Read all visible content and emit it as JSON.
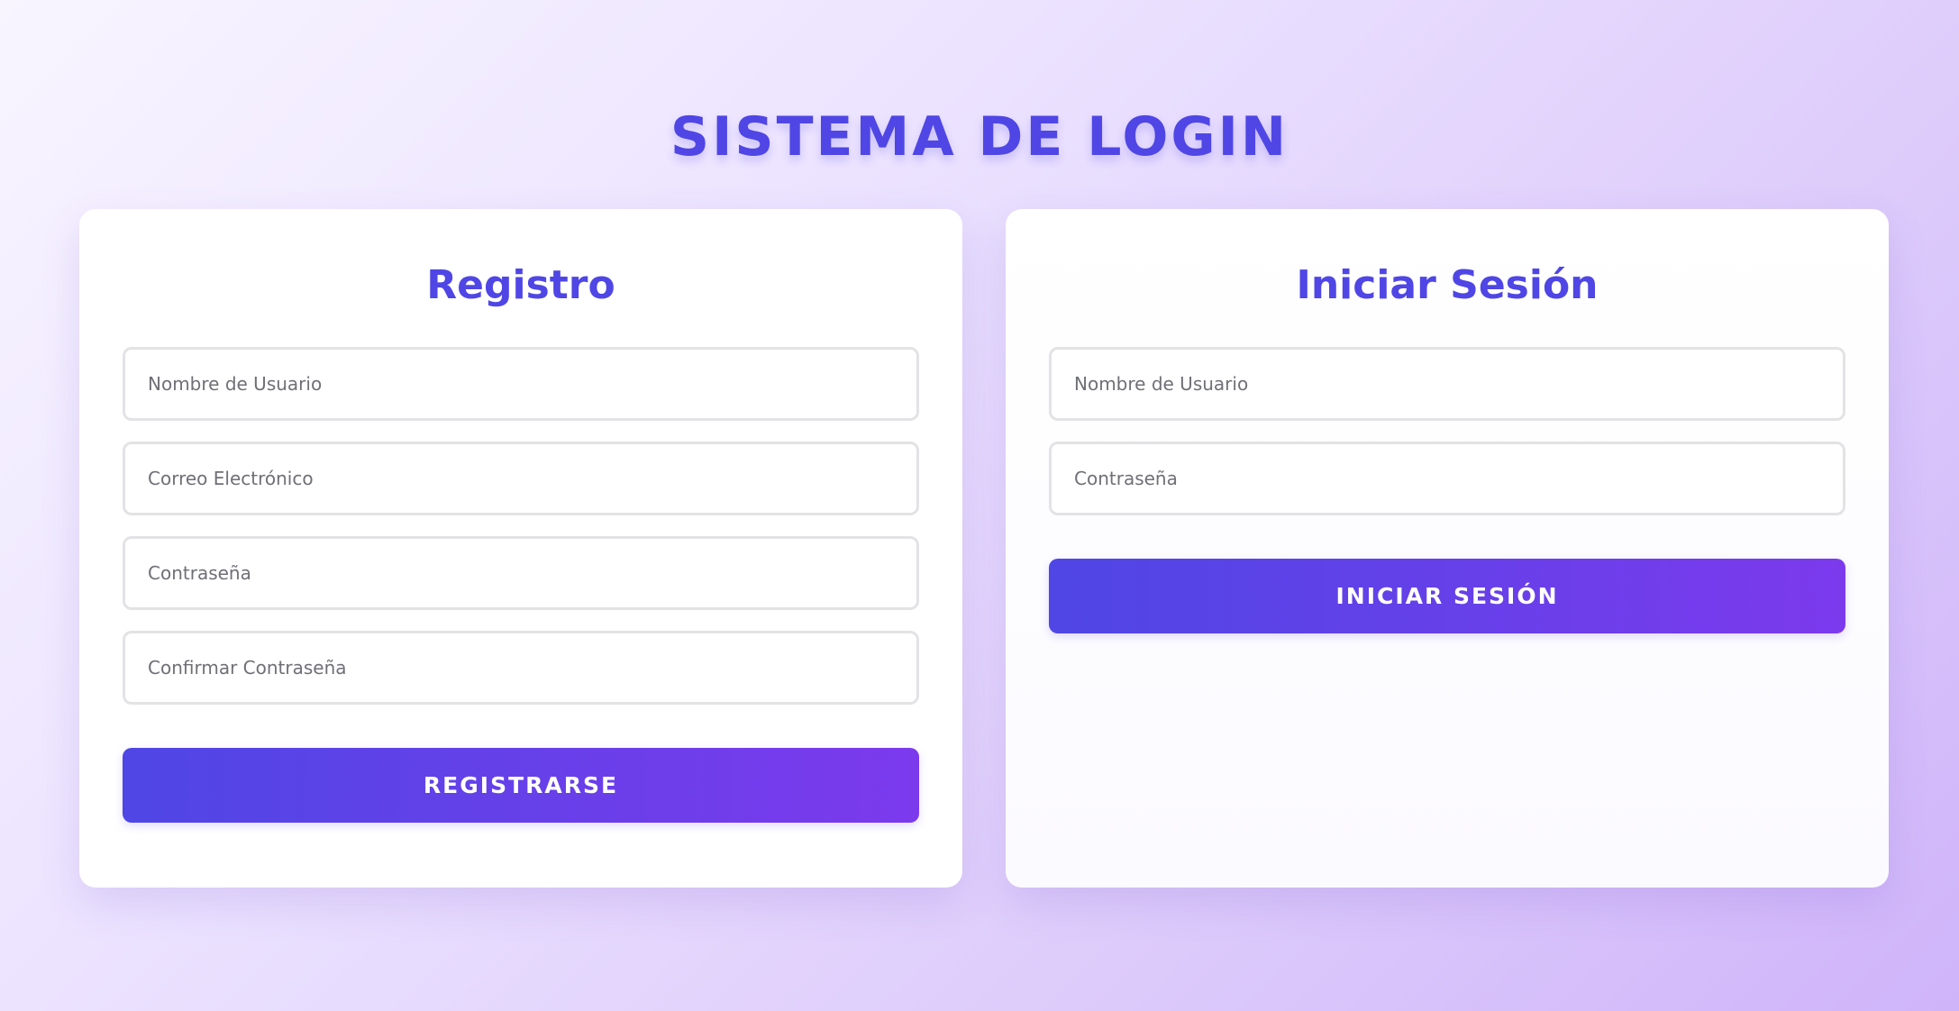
{
  "page": {
    "title": "SISTEMA DE LOGIN"
  },
  "register": {
    "title": "Registro",
    "username_placeholder": "Nombre de Usuario",
    "email_placeholder": "Correo Electrónico",
    "password_placeholder": "Contraseña",
    "confirm_password_placeholder": "Confirmar Contraseña",
    "submit_label": "REGISTRARSE"
  },
  "login": {
    "title": "Iniciar Sesión",
    "username_placeholder": "Nombre de Usuario",
    "password_placeholder": "Contraseña",
    "submit_label": "INICIAR SESIÓN"
  },
  "colors": {
    "accent": "#4f46e5",
    "accent_end": "#7c3aed",
    "background_start": "#f8f5ff",
    "background_end": "#cfb4fa",
    "field_border": "#e3e3e6"
  }
}
